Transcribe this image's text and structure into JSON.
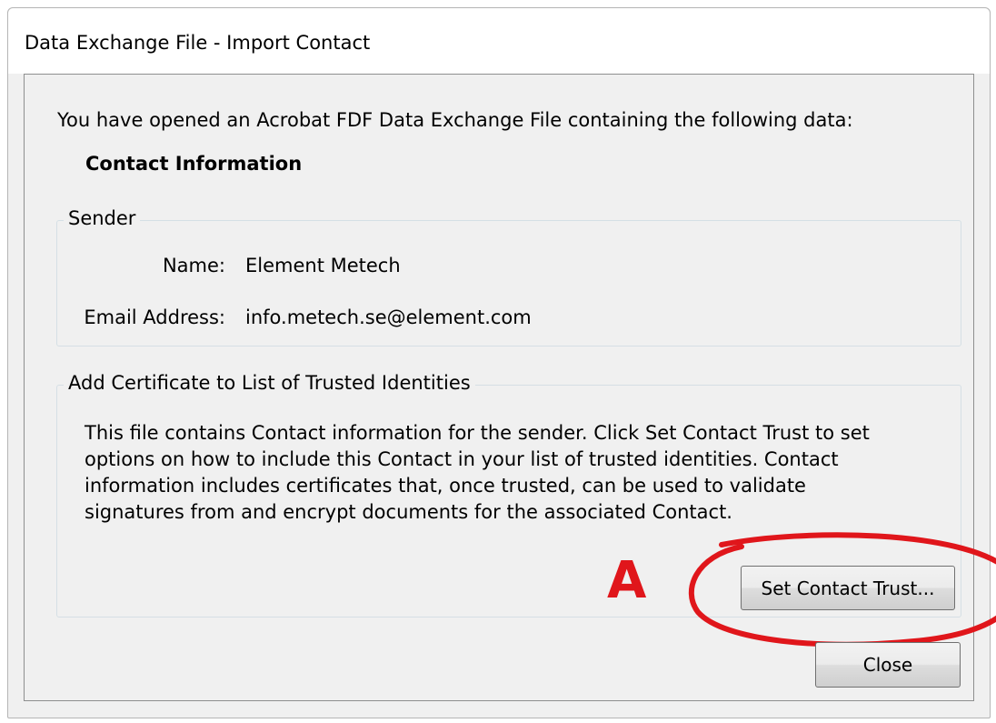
{
  "window": {
    "title": "Data Exchange File - Import Contact"
  },
  "intro_text": "You have opened an Acrobat FDF Data Exchange File containing the following data:",
  "section_heading": "Contact Information",
  "sender": {
    "legend": "Sender",
    "name_label": "Name:",
    "name_value": "Element Metech",
    "email_label": "Email Address:",
    "email_value": "info.metech.se@element.com"
  },
  "certificate": {
    "legend": "Add Certificate to List of Trusted Identities",
    "description": "This file contains Contact information for the sender. Click Set Contact Trust to set options on how to include this Contact in your list of trusted identities. Contact information includes certificates that, once trusted, can be used to validate signatures from and encrypt documents for the associated Contact.",
    "set_trust_button": "Set Contact Trust..."
  },
  "annotation": {
    "letter": "A",
    "color": "#e0161b"
  },
  "buttons": {
    "close": "Close"
  }
}
